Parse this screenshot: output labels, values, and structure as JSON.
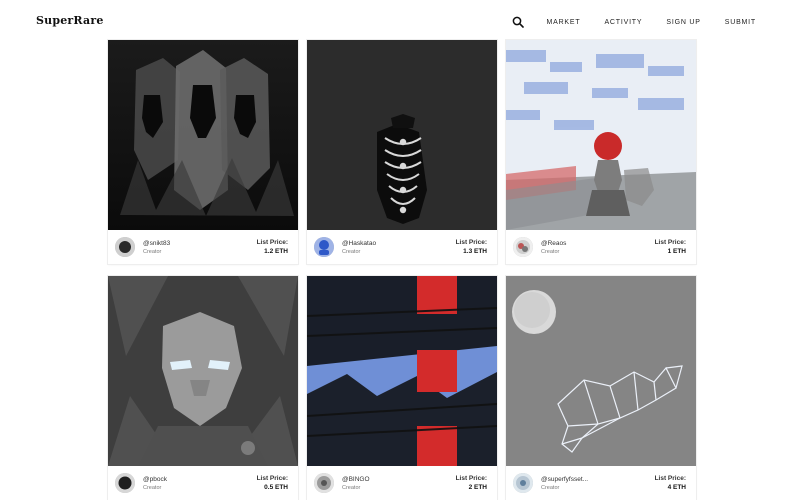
{
  "header": {
    "logo": "SuperRare",
    "nav": [
      "MARKET",
      "ACTIVITY",
      "SIGN UP",
      "SUBMIT"
    ]
  },
  "cards": [
    {
      "handle": "@snikt83",
      "role": "Creator",
      "price_label": "List Price:",
      "price": "1.2 ETH"
    },
    {
      "handle": "@Haskatao",
      "role": "Creator",
      "price_label": "List Price:",
      "price": "1.3 ETH"
    },
    {
      "handle": "@Reaos",
      "role": "Creator",
      "price_label": "List Price:",
      "price": "1 ETH"
    },
    {
      "handle": "@pbock",
      "role": "Creator",
      "price_label": "List Price:",
      "price": "0.5 ETH"
    },
    {
      "handle": "@BINGO",
      "role": "Creator",
      "price_label": "List Price:",
      "price": "2 ETH"
    },
    {
      "handle": "@superfyfsset...",
      "role": "Creator",
      "price_label": "List Price:",
      "price": "4 ETH"
    }
  ],
  "icons": {
    "search": "search-icon"
  },
  "colors": {
    "text": "#222222",
    "subtext": "#7a7a7a",
    "card_border": "#eeeeee"
  }
}
